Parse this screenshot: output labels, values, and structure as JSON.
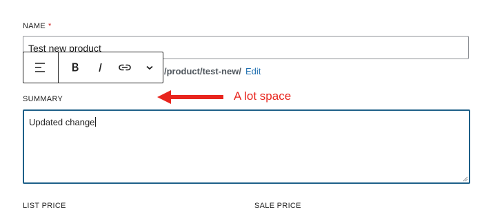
{
  "name_field": {
    "label": "NAME",
    "required_mark": "*",
    "value": "Test new product"
  },
  "permalink": {
    "path": "/product/test-new/",
    "edit_label": "Edit"
  },
  "toolbar": {
    "items": [
      {
        "icon": "align-left-icon"
      },
      {
        "icon": "bold-icon"
      },
      {
        "icon": "italic-icon"
      },
      {
        "icon": "link-icon"
      },
      {
        "icon": "chevron-down-icon"
      }
    ]
  },
  "summary_field": {
    "label": "SUMMARY",
    "value": "Updated change"
  },
  "annotation": {
    "text": "A lot space",
    "color": "#e8251e"
  },
  "price_fields": {
    "list_price_label": "LIST PRICE",
    "sale_price_label": "SALE PRICE"
  },
  "colors": {
    "focus_border": "#1d5f88",
    "link": "#2271b1",
    "required": "#cc1818"
  }
}
